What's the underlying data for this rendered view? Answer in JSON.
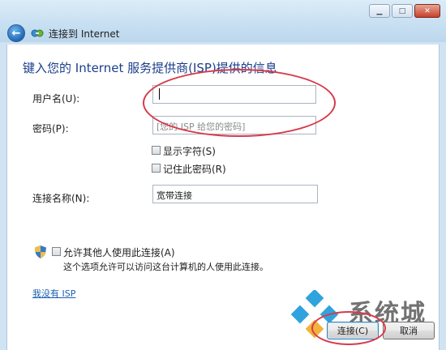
{
  "window": {
    "title": "连接到 Internet",
    "controls": {
      "minimize": "▁",
      "maximize": "□",
      "close": "✕"
    }
  },
  "page": {
    "heading": "键入您的 Internet 服务提供商(ISP)提供的信息"
  },
  "form": {
    "username": {
      "label": "用户名(U):",
      "value": ""
    },
    "password": {
      "label": "密码(P):",
      "placeholder": "[您的 ISP 给您的密码]"
    },
    "show_chars": {
      "label": "显示字符(S)",
      "checked": false
    },
    "remember_password": {
      "label": "记住此密码(R)",
      "checked": false
    },
    "connection_name": {
      "label": "连接名称(N):",
      "value": "宽带连接"
    },
    "allow_others": {
      "label": "允许其他人使用此连接(A)",
      "checked": false,
      "description": "这个选项允许可以访问这台计算机的人使用此连接。"
    }
  },
  "links": {
    "no_isp": "我没有 ISP"
  },
  "buttons": {
    "connect": "连接(C)",
    "cancel": "取消"
  },
  "watermark": {
    "text": "系统城"
  },
  "colors": {
    "heading": "#1b3f8b",
    "link": "#1a5fb4",
    "annotation": "#d83a4a",
    "titlebar": "#c7dff2"
  },
  "icons": {
    "back": "back-arrow-icon",
    "network": "network-connection-icon",
    "shield": "uac-shield-icon"
  }
}
